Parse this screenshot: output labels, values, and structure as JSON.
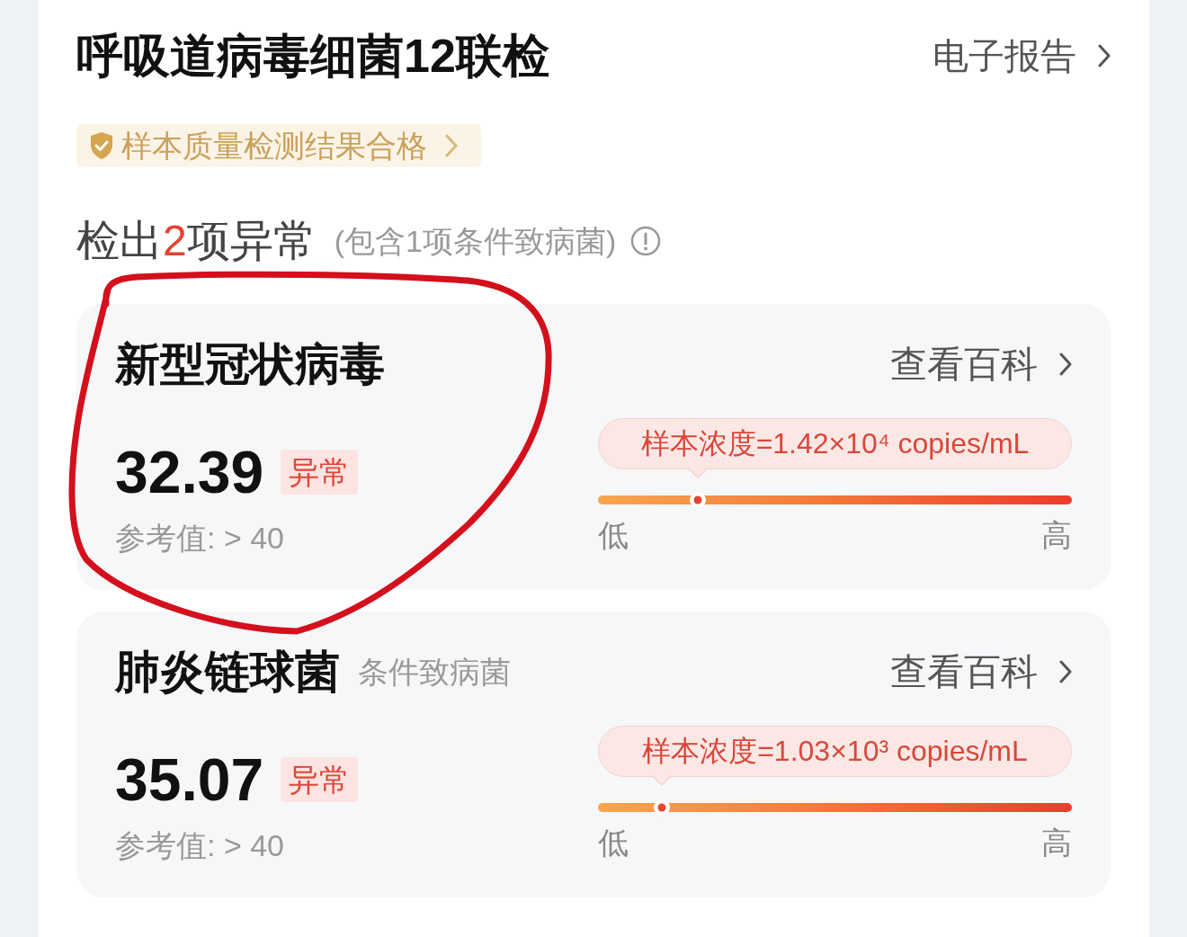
{
  "header": {
    "title": "呼吸道病毒细菌12联检",
    "report_link": "电子报告"
  },
  "quality_badge": {
    "text": "样本质量检测结果合格"
  },
  "summary": {
    "prefix": "检出",
    "count": "2",
    "suffix": "项异常",
    "note": "(包含1项条件致病菌)"
  },
  "results": [
    {
      "name": "新型冠状病毒",
      "link": "查看百科",
      "value": "32.39",
      "status": "异常",
      "reference": "参考值: > 40",
      "concentration": "样本浓度=1.42×10⁴ copies/mL",
      "level": 0.21,
      "scale_low": "低",
      "scale_high": "高"
    },
    {
      "name": "肺炎链球菌",
      "category": "条件致病菌",
      "link": "查看百科",
      "value": "35.07",
      "status": "异常",
      "reference": "参考值: > 40",
      "concentration": "样本浓度=1.03×10³ copies/mL",
      "level": 0.135,
      "scale_low": "低",
      "scale_high": "高"
    }
  ]
}
